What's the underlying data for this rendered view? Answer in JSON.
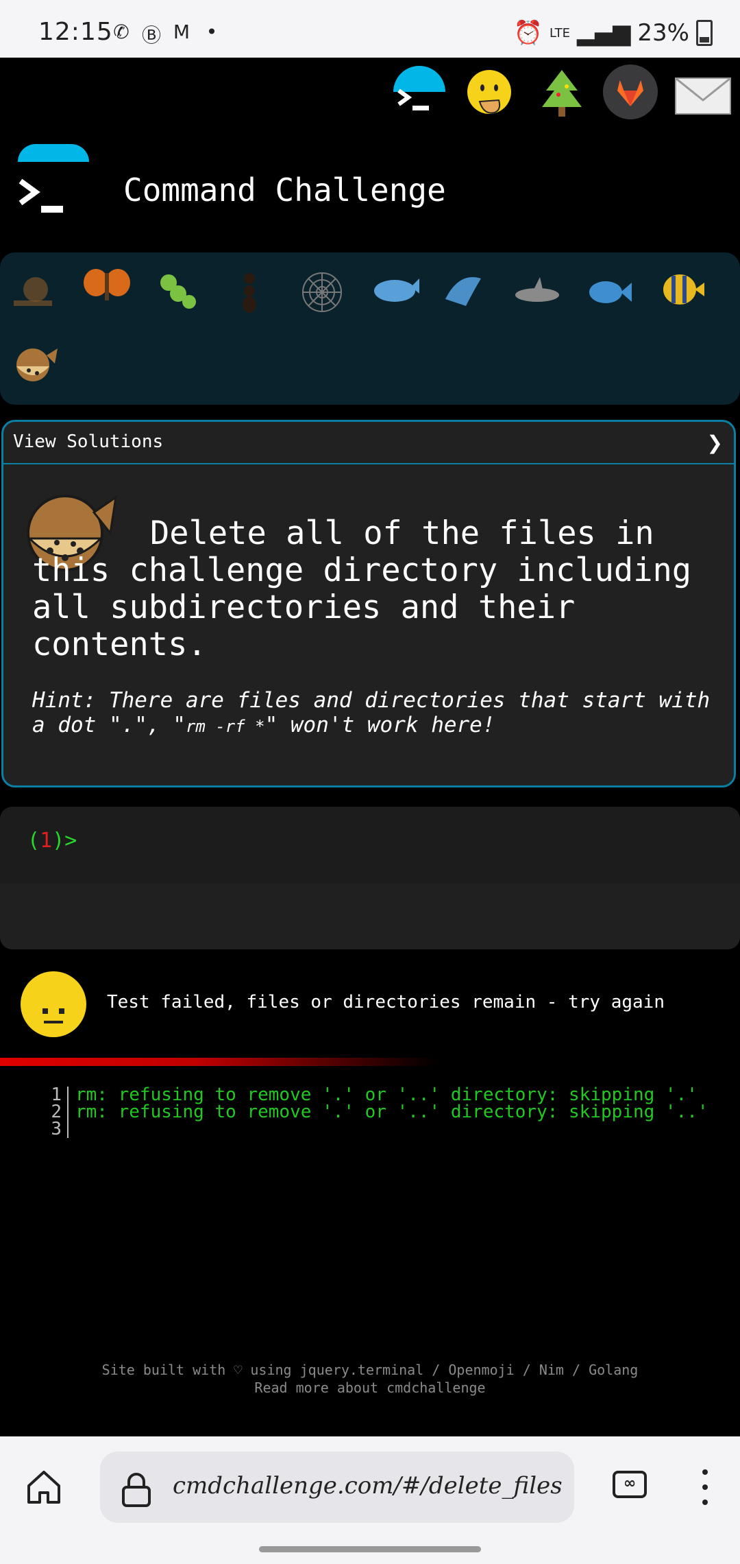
{
  "status_bar": {
    "time": "12:15",
    "network": "LTE",
    "battery": "23%",
    "left_icons": [
      "whatsapp-icon",
      "b-icon",
      "gmail-icon",
      "dot-icon"
    ],
    "right_icons": [
      "alarm-icon",
      "lte-icon",
      "signal-icon",
      "battery-icon"
    ]
  },
  "top_icons": [
    "terminal-logo-icon",
    "hand-over-mouth-face-icon",
    "christmas-tree-icon",
    "gitlab-icon",
    "mail-icon"
  ],
  "header": {
    "title": "Command Challenge"
  },
  "animals": [
    "snail",
    "butterfly",
    "caterpillar",
    "ant",
    "spider-web",
    "whale",
    "dolphin",
    "shark",
    "fish",
    "tropical-fish",
    "blowfish"
  ],
  "panel": {
    "view_solutions": "View Solutions",
    "chevron": "❯",
    "challenge_text": "Delete all of the files in this challenge directory including all subdirectories and their contents.",
    "hint_prefix": "Hint: There are files and directories that start with a dot \".\", \"",
    "hint_code": "rm -rf *",
    "hint_suffix": "\" won't work here!"
  },
  "terminal": {
    "prompt_open": "(",
    "prompt_number": "1",
    "prompt_close": ")>"
  },
  "result": {
    "message": "Test failed, files or directories remain - try again"
  },
  "output": [
    {
      "line": "1",
      "text": "rm: refusing to remove '.' or '..' directory: skipping '.'"
    },
    {
      "line": "2",
      "text": "rm: refusing to remove '.' or '..' directory: skipping '..'"
    },
    {
      "line": "3",
      "text": ""
    }
  ],
  "footer": {
    "line1": "Site built with ♡ using jquery.terminal / Openmoji / Nim / Golang",
    "line2": "Read more about cmdchallenge"
  },
  "browser": {
    "url": "cmdchallenge.com/#/delete_files",
    "tab_label": "∞"
  },
  "colors": {
    "accent": "#00b7e8",
    "panel_border": "#0a7fa3",
    "output_green": "#21c821",
    "error_red": "#e00000"
  }
}
